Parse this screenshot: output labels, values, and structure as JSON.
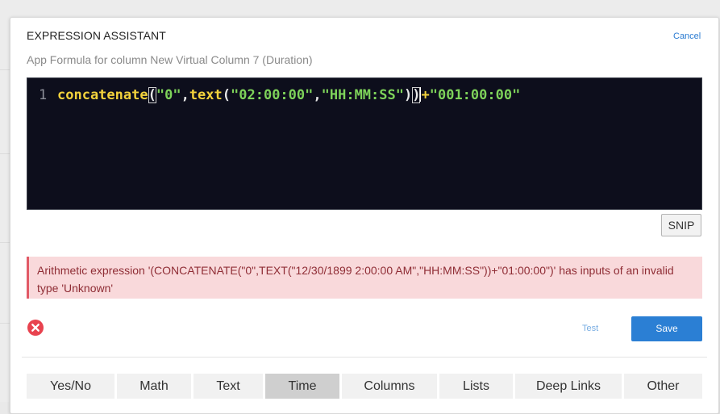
{
  "dialog": {
    "title": "EXPRESSION ASSISTANT",
    "cancel_label": "Cancel",
    "subtitle": "App Formula for column New Virtual Column 7 (Duration)"
  },
  "editor": {
    "line_number": "1",
    "tokens": {
      "fn1": "concatenate",
      "open1": "(",
      "str1": "\"0\"",
      "comma1": ",",
      "fn2": "text",
      "open2": "(",
      "str2": "\"02:00:00\"",
      "comma2": ",",
      "str3": "\"HH:MM:SS\"",
      "close2": ")",
      "close1": ")",
      "plus": "+",
      "str4": "\"001:00:00\""
    },
    "snip_label": "SNIP"
  },
  "error": {
    "message": "Arithmetic expression '(CONCATENATE(\"0\",TEXT(\"12/30/1899 2:00:00 AM\",\"HH:MM:SS\"))+\"01:00:00\")' has inputs of an invalid type 'Unknown'"
  },
  "actions": {
    "test_label": "Test",
    "save_label": "Save"
  },
  "tabs": [
    {
      "label": "Yes/No"
    },
    {
      "label": "Math"
    },
    {
      "label": "Text"
    },
    {
      "label": "Time"
    },
    {
      "label": "Columns"
    },
    {
      "label": "Lists"
    },
    {
      "label": "Deep Links"
    },
    {
      "label": "Other"
    }
  ],
  "active_tab": "Time",
  "colors": {
    "accent": "#2b7fd4",
    "editor_bg": "#0d0e1c",
    "function": "#f2d23c",
    "string": "#7ed35a",
    "error_bg": "#f9d9db",
    "error_icon": "#e8434f"
  },
  "icons": {
    "error": "x-circle-icon"
  }
}
